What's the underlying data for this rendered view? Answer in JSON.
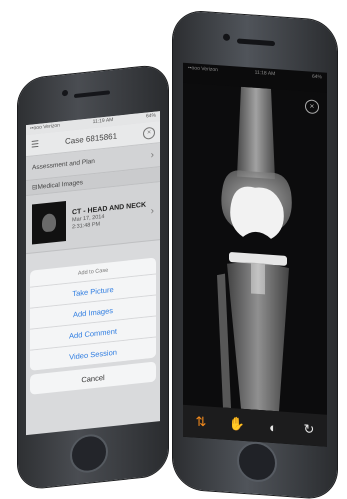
{
  "left_phone": {
    "status": {
      "carrier": "••ooo Verizon",
      "time": "11:19 AM",
      "battery": "64%"
    },
    "header": {
      "title": "Case 6815861",
      "menu_icon": "menu-icon",
      "close_icon": "close-icon"
    },
    "rows": [
      {
        "label": "Assessment and Plan"
      }
    ],
    "section": {
      "label": "Medical Images"
    },
    "image_item": {
      "title": "CT - HEAD AND NECK",
      "date": "Mar 17, 2014",
      "time": "2:31:48 PM"
    },
    "action_sheet": {
      "heading": "Add to Case",
      "actions": [
        "Take Picture",
        "Add Images",
        "Add Comment",
        "Video Session"
      ],
      "cancel": "Cancel"
    }
  },
  "right_phone": {
    "status": {
      "carrier": "••ooo Verizon",
      "time": "11:18 AM",
      "battery": "64%"
    },
    "close_icon": "close-icon",
    "toolbar": [
      {
        "name": "sort-arrows-icon",
        "glyph": "⇅",
        "active": true
      },
      {
        "name": "hand-pan-icon",
        "glyph": "✋",
        "active": false
      },
      {
        "name": "contrast-icon",
        "glyph": "◐",
        "active": false
      },
      {
        "name": "rotate-icon",
        "glyph": "↻",
        "active": false
      }
    ],
    "colors": {
      "accent": "#f28a1c",
      "link": "#2f7de1"
    }
  }
}
